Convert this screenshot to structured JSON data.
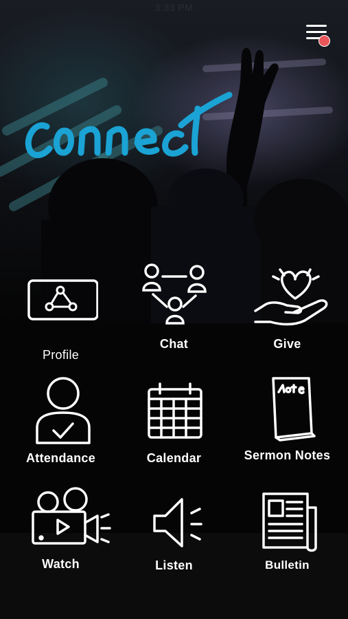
{
  "status_bar": {
    "time": "3:33 PM"
  },
  "header": {
    "logo_text": "connect",
    "menu_icon": "hamburger-menu-icon",
    "notification_color": "#e8565a"
  },
  "accent_color": "#1aa3d4",
  "tiles": [
    {
      "label": "Profile",
      "icon": "profile-card-icon"
    },
    {
      "label": "Chat",
      "icon": "people-network-icon"
    },
    {
      "label": "Give",
      "icon": "heart-hand-icon"
    },
    {
      "label": "Attendance",
      "icon": "person-check-icon"
    },
    {
      "label": "Calendar",
      "icon": "calendar-icon"
    },
    {
      "label": "Sermon Notes",
      "icon": "notebook-icon"
    },
    {
      "label": "Watch",
      "icon": "video-camera-icon"
    },
    {
      "label": "Listen",
      "icon": "speaker-icon"
    },
    {
      "label": "Bulletin",
      "icon": "newspaper-icon"
    }
  ]
}
